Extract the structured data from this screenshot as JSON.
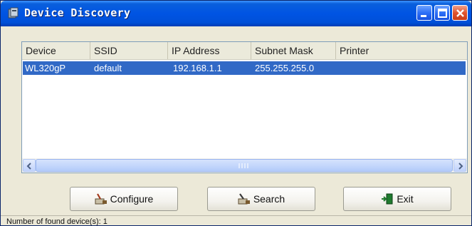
{
  "window": {
    "title": "Device Discovery"
  },
  "table": {
    "columns": [
      "Device",
      "SSID",
      "IP Address",
      "Subnet Mask",
      "Printer"
    ],
    "rows": [
      {
        "device": "WL320gP",
        "ssid": "default",
        "ip": "192.168.1.1",
        "mask": "255.255.255.0",
        "printer": ""
      }
    ]
  },
  "buttons": {
    "configure": "Configure",
    "search": "Search",
    "exit": "Exit"
  },
  "status": {
    "text": "Number of found device(s): 1"
  },
  "icons": {
    "title": "app-icon",
    "configure": "configure-icon",
    "search": "search-icon",
    "exit": "exit-door-icon"
  },
  "colors": {
    "titlebar": "#0054e3",
    "selection": "#3169c6",
    "close": "#e0542e"
  }
}
